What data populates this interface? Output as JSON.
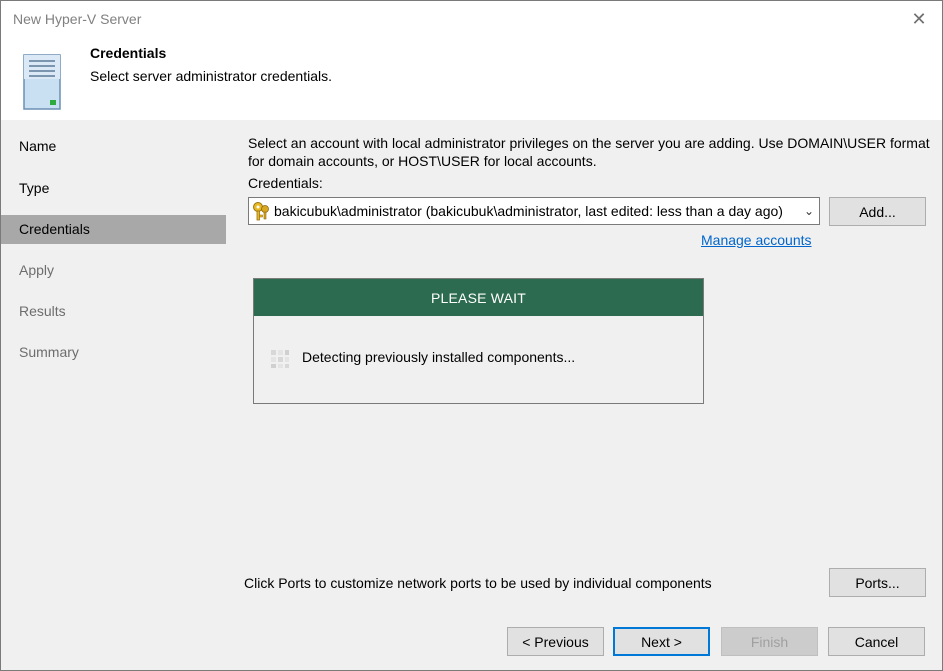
{
  "window": {
    "title": "New Hyper-V Server",
    "close_label": "✕"
  },
  "header": {
    "title": "Credentials",
    "subtitle": "Select server administrator credentials.",
    "icon": "server-icon"
  },
  "sidebar": {
    "steps": [
      {
        "label": "Name",
        "state": "normal"
      },
      {
        "label": "Type",
        "state": "normal"
      },
      {
        "label": "Credentials",
        "state": "active"
      },
      {
        "label": "Apply",
        "state": "disabled"
      },
      {
        "label": "Results",
        "state": "disabled"
      },
      {
        "label": "Summary",
        "state": "disabled"
      }
    ]
  },
  "content": {
    "description": "Select an account with local administrator privileges on the server you are adding. Use DOMAIN\\USER format for domain accounts, or HOST\\USER for local accounts.",
    "credentials_label": "Credentials:",
    "credentials_value": "bakicubuk\\administrator (bakicubuk\\administrator, last edited: less than a day ago)",
    "add_button": "Add...",
    "manage_accounts_link": "Manage accounts",
    "wait": {
      "header": "PLEASE WAIT",
      "message": "Detecting previously installed components..."
    },
    "ports_text": "Click Ports to customize network ports to be used by individual components",
    "ports_button": "Ports..."
  },
  "footer": {
    "previous": "< Previous",
    "next": "Next >",
    "finish": "Finish",
    "cancel": "Cancel"
  },
  "colors": {
    "wait_header": "#2c6b4f",
    "active_step": "#a8a8a8",
    "link": "#0066cc",
    "primary_border": "#0078d7"
  }
}
